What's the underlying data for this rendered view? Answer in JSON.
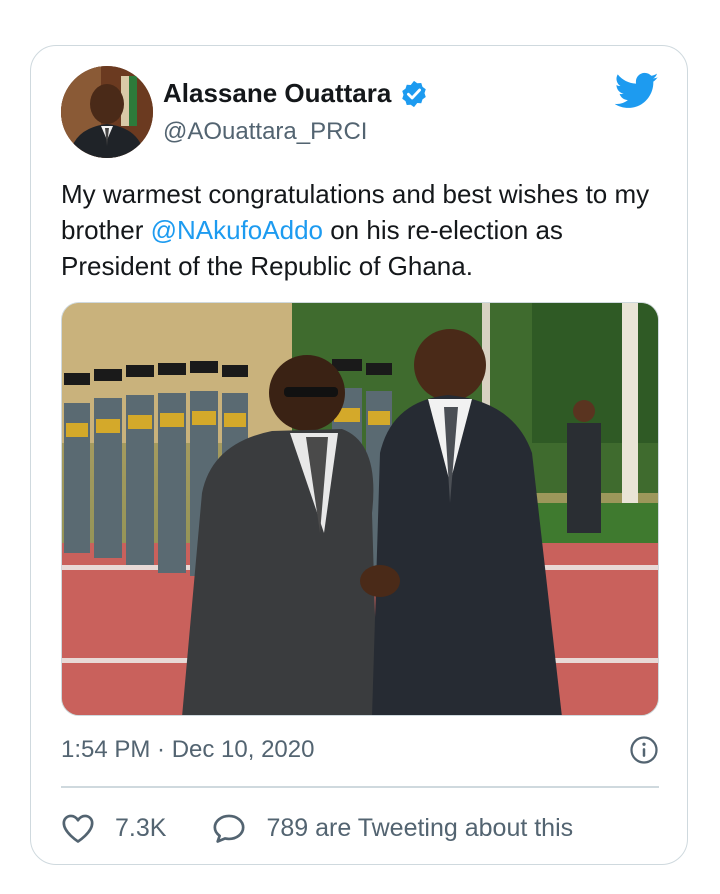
{
  "tweet": {
    "author": {
      "display_name": "Alassane Ouattara",
      "handle": "@AOuattara_PRCI",
      "verified": true
    },
    "text_before_mention": "My warmest congratulations and best wishes to my brother ",
    "mention": "@NAkufoAddo",
    "text_after_mention": " on his re-election as President of the Republic of Ghana.",
    "timestamp": "1:54 PM · Dec 10, 2020",
    "likes_count": "7.3K",
    "conversation_text": "789 are Tweeting about this"
  },
  "icons": {
    "brand": "twitter-bird-icon",
    "verified": "verified-badge-icon",
    "info": "info-icon",
    "like": "heart-icon",
    "reply": "speech-bubble-icon"
  },
  "colors": {
    "twitter_blue": "#1d9bf0",
    "text_primary": "#14171a",
    "text_secondary": "#536471",
    "border": "#cfd9de"
  }
}
